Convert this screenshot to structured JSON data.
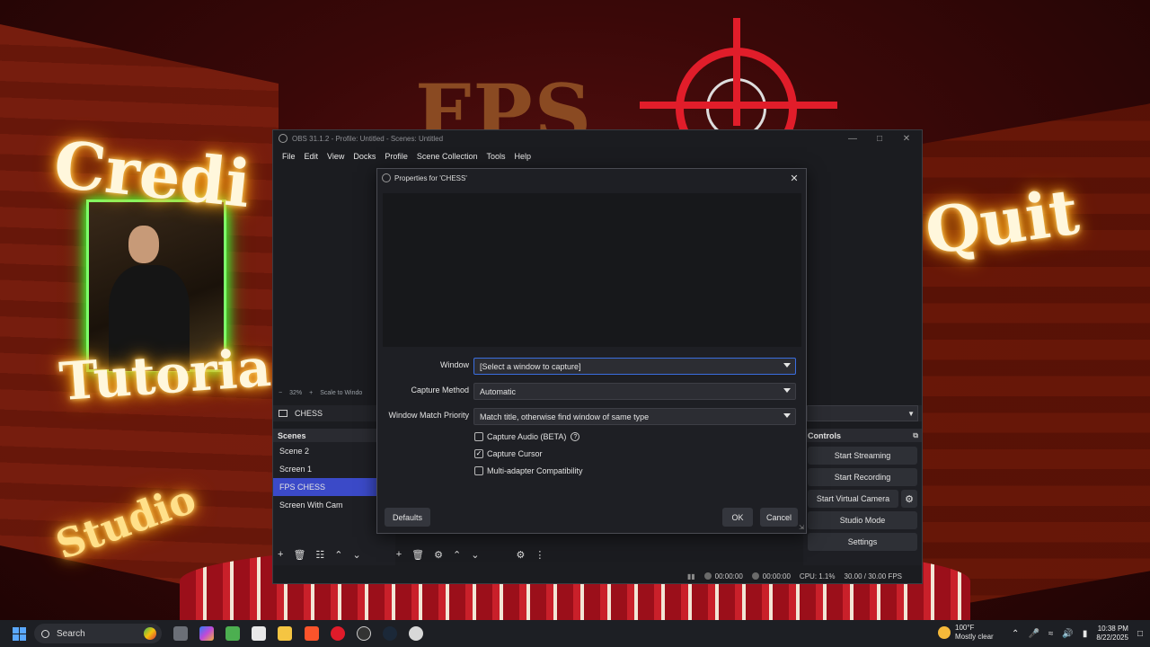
{
  "background": {
    "title": "FPS",
    "credits": "Credi",
    "tutorial": "Tutoria",
    "quit": "Quit",
    "studio": "Studio"
  },
  "obs": {
    "title": "OBS 31.1.2 - Profile: Untitled - Scenes: Untitled",
    "menu": [
      "File",
      "Edit",
      "View",
      "Docks",
      "Profile",
      "Scene Collection",
      "Tools",
      "Help"
    ],
    "preview_status": {
      "zoom": "32%",
      "mode": "Scale to Windo"
    },
    "source_name": "CHESS",
    "scenes": {
      "header": "Scenes",
      "items": [
        "Scene 2",
        "Screen 1",
        "FPS CHESS",
        "Screen With Cam"
      ],
      "selected_index": 2
    },
    "controls": {
      "header": "Controls",
      "buttons": [
        "Start Streaming",
        "Start Recording",
        "Start Virtual Camera",
        "Studio Mode",
        "Settings"
      ]
    },
    "status": {
      "stream_time": "00:00:00",
      "record_time": "00:00:00",
      "cpu": "CPU: 1.1%",
      "fps": "30.00 / 30.00 FPS"
    }
  },
  "dialog": {
    "title": "Properties for 'CHESS'",
    "window_label": "Window",
    "window_value": "[Select a window to capture]",
    "capture_method_label": "Capture Method",
    "capture_method_value": "Automatic",
    "match_priority_label": "Window Match Priority",
    "match_priority_value": "Match title, otherwise find window of same type",
    "checkboxes": [
      {
        "label": "Capture Audio (BETA)",
        "checked": false
      },
      {
        "label": "Capture Cursor",
        "checked": true
      },
      {
        "label": "Multi-adapter Compatibility",
        "checked": false
      }
    ],
    "defaults_label": "Defaults",
    "ok_label": "OK",
    "cancel_label": "Cancel"
  },
  "taskbar": {
    "search_placeholder": "Search",
    "weather_temp": "100°F",
    "weather_desc": "Mostly clear",
    "time": "10:38 PM",
    "date": "8/22/2025"
  },
  "colors": {
    "accent": "#3b4ac8",
    "focus": "#3b6ee0",
    "crosshair": "#e11d2a"
  }
}
